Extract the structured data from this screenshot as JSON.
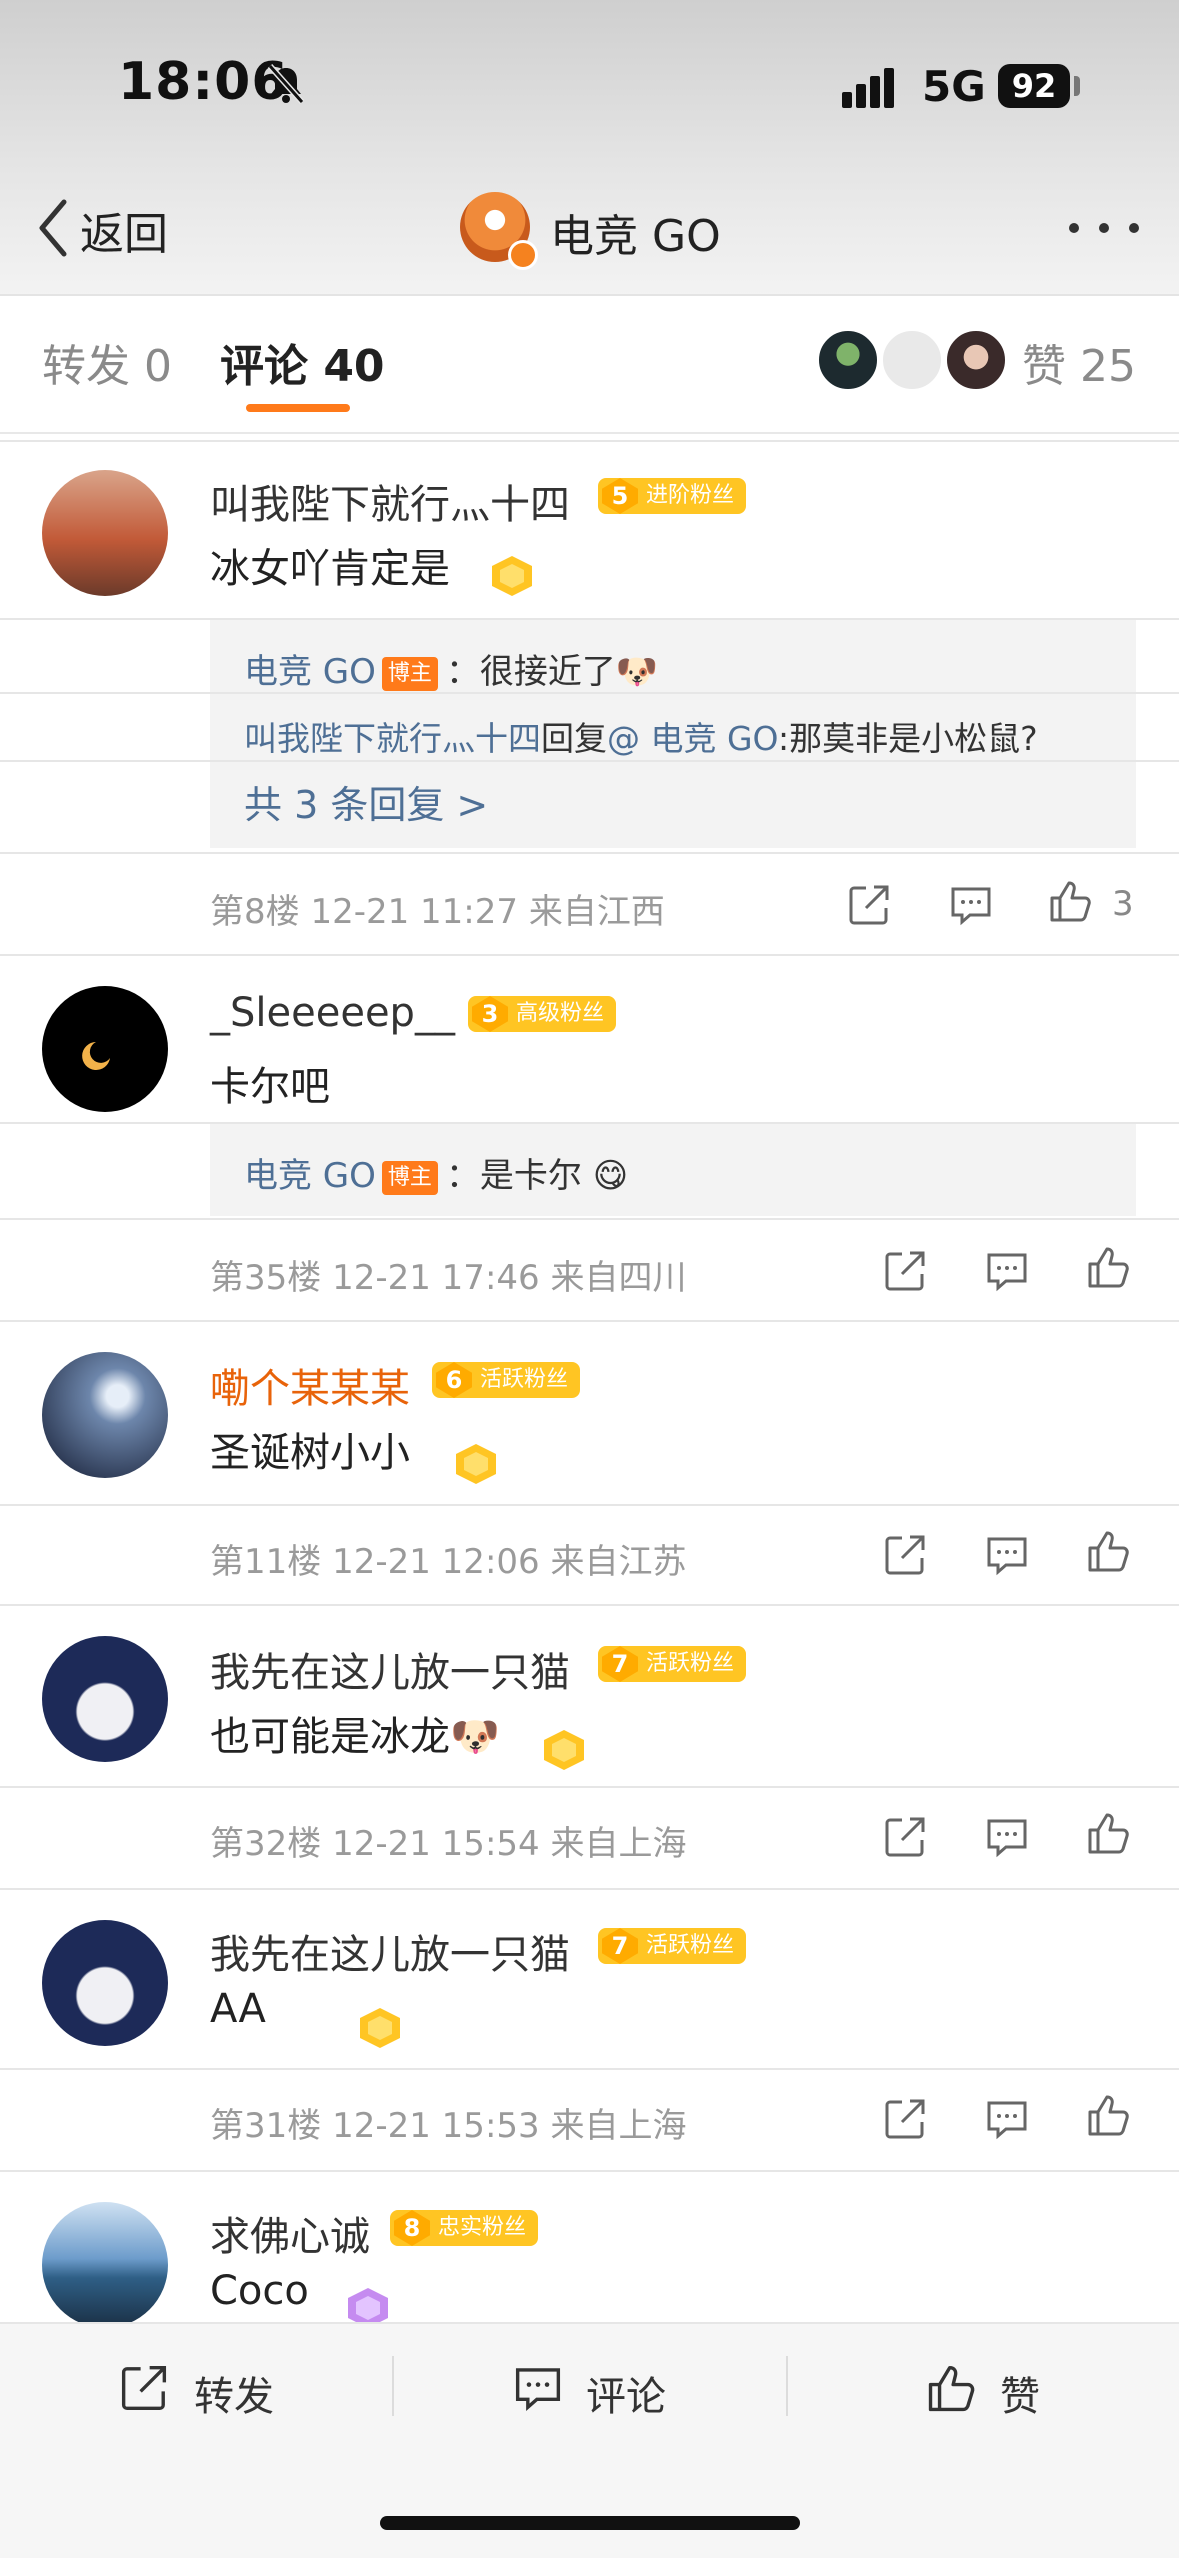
{
  "status_bar": {
    "time": "18:06",
    "network": "5G",
    "battery": "92"
  },
  "nav": {
    "back_label": "返回",
    "title": "电竞 GO"
  },
  "tabs": {
    "repost": "转发 0",
    "comment": "评论 40",
    "like": "赞 25"
  },
  "comments": [
    {
      "user": "叫我陛下就行灬十四",
      "level": "5",
      "badge": "进阶粉丝",
      "text": "冰女吖肯定是",
      "replies": [
        {
          "user": "电竞 GO",
          "author_tag": "博主",
          "text": "：很接近了🐶"
        },
        {
          "user": "叫我陛下就行灬十四",
          "mid": "回复",
          "to": "@ 电竞 GO",
          "text": ":那莫非是小松鼠?"
        }
      ],
      "more_replies": "共 3 条回复 >",
      "meta": "第8楼 12-21 11:27  来自江西",
      "likes": "3"
    },
    {
      "user": "_Sleeeeep__",
      "level": "3",
      "badge": "高级粉丝",
      "text": "卡尔吧",
      "replies": [
        {
          "user": "电竞 GO",
          "author_tag": "博主",
          "text": "：是卡尔 😋"
        }
      ],
      "meta": "第35楼 12-21 17:46  来自四川"
    },
    {
      "user": "嘞个某某某",
      "level": "6",
      "badge": "活跃粉丝",
      "text": "圣诞树小小",
      "meta": "第11楼 12-21 12:06  来自江苏"
    },
    {
      "user": "我先在这儿放一只猫",
      "level": "7",
      "badge": "活跃粉丝",
      "text": "也可能是冰龙🐶",
      "meta": "第32楼 12-21 15:54  来自上海"
    },
    {
      "user": "我先在这儿放一只猫",
      "level": "7",
      "badge": "活跃粉丝",
      "text": "AA",
      "meta": "第31楼 12-21 15:53  来自上海"
    },
    {
      "user": "求佛心诚",
      "level": "8",
      "badge": "忠实粉丝",
      "text": "Coco"
    }
  ],
  "bottom_bar": {
    "repost": "转发",
    "comment": "评论",
    "like": "赞"
  },
  "colors": {
    "accent": "#ff7a1a",
    "link": "#4e6f95",
    "badge": "#ffc523",
    "vip_name": "#e8630a"
  }
}
